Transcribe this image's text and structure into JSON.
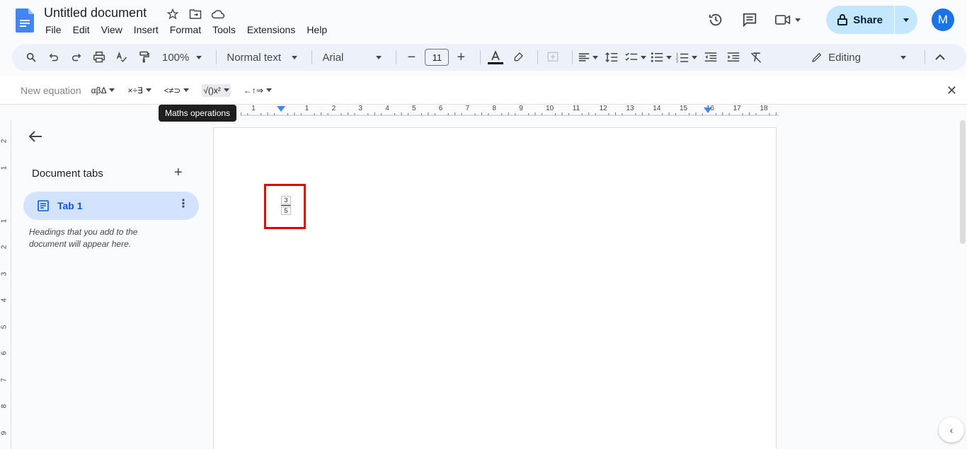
{
  "document": {
    "title": "Untitled document"
  },
  "menu": [
    "File",
    "Edit",
    "View",
    "Insert",
    "Format",
    "Tools",
    "Extensions",
    "Help"
  ],
  "header": {
    "share_label": "Share",
    "avatar_letter": "M"
  },
  "toolbar": {
    "zoom": "100%",
    "style": "Normal text",
    "font": "Arial",
    "font_size": "11",
    "mode": "Editing"
  },
  "equation_bar": {
    "new_equation": "New equation",
    "groups": [
      "αβΔ",
      "×÷∃",
      "<≠⊃",
      "√()x²",
      "←↑⇒"
    ],
    "tooltip": "Maths operations"
  },
  "ruler": {
    "h_marks": [
      "1",
      "1",
      "2",
      "3",
      "4",
      "5",
      "6",
      "7",
      "8",
      "9",
      "10",
      "11",
      "12",
      "13",
      "14",
      "15",
      "16",
      "17",
      "18"
    ],
    "v_marks": [
      "2",
      "1",
      "",
      "1",
      "2",
      "3",
      "4",
      "5",
      "6",
      "7",
      "8",
      "9"
    ]
  },
  "sidebar": {
    "heading": "Document tabs",
    "tab_label": "Tab 1",
    "hint": "Headings that you add to the document will appear here."
  },
  "equation": {
    "numerator": "3",
    "denominator": "5"
  },
  "colors": {
    "accent": "#0b57d0",
    "share_bg": "#c2e7ff",
    "tab_active": "#d3e3fd",
    "highlight": "#e00000"
  }
}
